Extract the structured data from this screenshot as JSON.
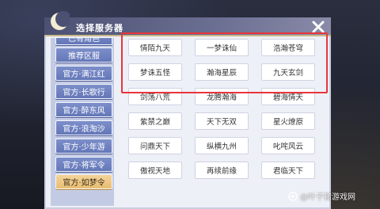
{
  "dialog": {
    "title": "选择服务器",
    "close_icon": "close-icon"
  },
  "sidebar": {
    "items": [
      {
        "label": "已有角色",
        "active": false
      },
      {
        "label": "推荐区服",
        "active": false
      },
      {
        "label": "官方·满江红",
        "active": false
      },
      {
        "label": "官方·长歌行",
        "active": false
      },
      {
        "label": "官方·醉东风",
        "active": false
      },
      {
        "label": "官方·浪淘沙",
        "active": false
      },
      {
        "label": "官方·少年游",
        "active": false
      },
      {
        "label": "官方·将军令",
        "active": false
      },
      {
        "label": "官方·如梦令",
        "active": true
      }
    ]
  },
  "servers": [
    {
      "name": "情陌九天"
    },
    {
      "name": "一梦诛仙"
    },
    {
      "name": "浩瀚苍穹"
    },
    {
      "name": "梦诛五怪"
    },
    {
      "name": "瀚海星辰"
    },
    {
      "name": "九天玄剑"
    },
    {
      "name": "剑荡八荒"
    },
    {
      "name": "龙腾瀚海"
    },
    {
      "name": "碧海情天"
    },
    {
      "name": "紫禁之巅"
    },
    {
      "name": "天下无双"
    },
    {
      "name": "星火燎原"
    },
    {
      "name": "问鼎天下"
    },
    {
      "name": "纵横九州"
    },
    {
      "name": "叱咤风云"
    },
    {
      "name": "傲视天地"
    },
    {
      "name": "再续前缘"
    },
    {
      "name": "君临天下"
    }
  ],
  "watermark": {
    "text": "@叶子猪游戏网"
  },
  "colors": {
    "highlight": "#e8353b",
    "sidebar_tab": "#6d7fbf",
    "active_tab": "#edc37e"
  }
}
